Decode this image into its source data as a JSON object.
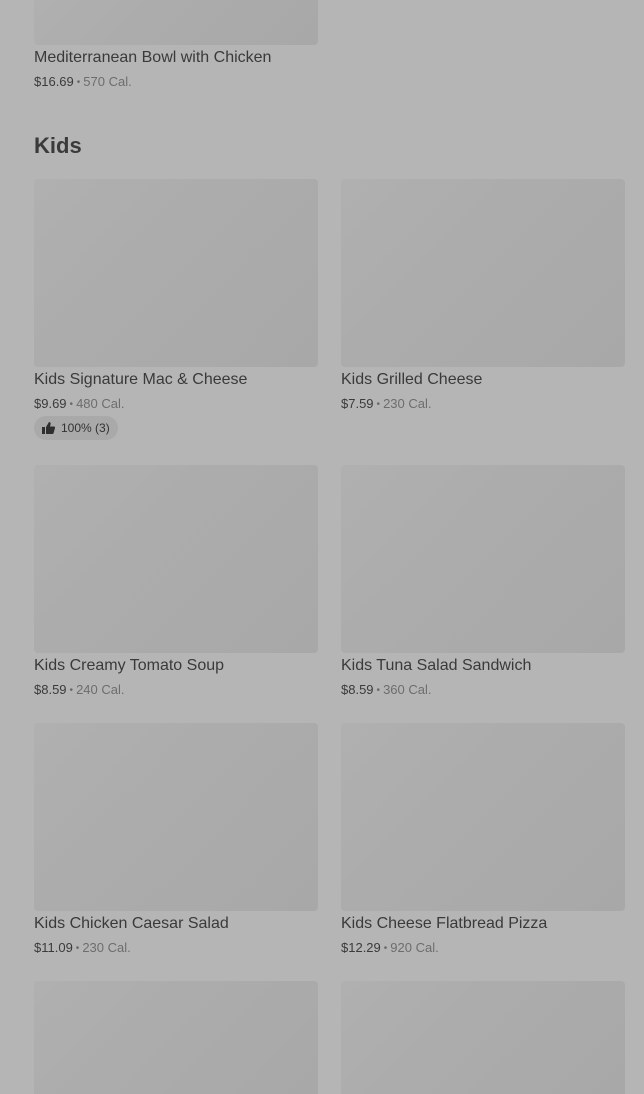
{
  "top_item": {
    "name": "Mediterranean Bowl with Chicken",
    "price": "$16.69",
    "separator": "•",
    "calories": "570 Cal."
  },
  "section": {
    "title": "Kids"
  },
  "items": [
    {
      "name": "Kids Signature Mac & Cheese",
      "price": "$9.69",
      "separator": "•",
      "calories": "480 Cal.",
      "rating": "100% (3)",
      "icon": "thumbs-up-icon"
    },
    {
      "name": "Kids Grilled Cheese",
      "price": "$7.59",
      "separator": "•",
      "calories": "230 Cal."
    },
    {
      "name": "Kids Creamy Tomato Soup",
      "price": "$8.59",
      "separator": "•",
      "calories": "240 Cal."
    },
    {
      "name": "Kids Tuna Salad Sandwich",
      "price": "$8.59",
      "separator": "•",
      "calories": "360 Cal."
    },
    {
      "name": "Kids Chicken Caesar Salad",
      "price": "$11.09",
      "separator": "•",
      "calories": "230 Cal."
    },
    {
      "name": "Kids Cheese Flatbread Pizza",
      "price": "$12.29",
      "separator": "•",
      "calories": "920 Cal."
    }
  ],
  "colors": {
    "overlay_background": "#b5b5b5",
    "image_placeholder": "#acacac",
    "text_primary": "#3a3a3a",
    "text_secondary": "#6d6d6d"
  }
}
